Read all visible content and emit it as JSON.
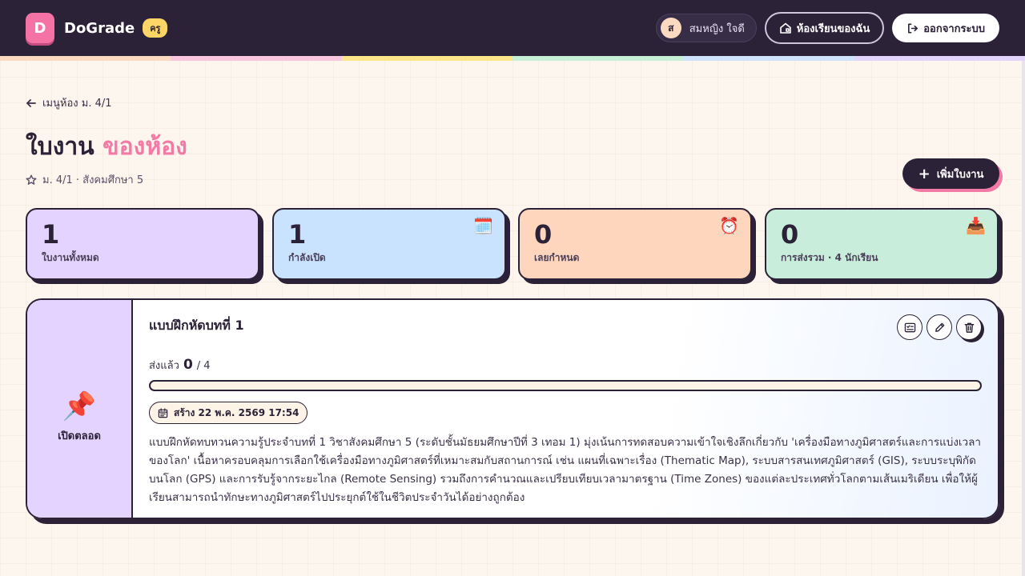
{
  "header": {
    "logo_letter": "D",
    "brand": "DoGrade",
    "role_badge": "ครู",
    "user": {
      "initial": "ส",
      "name": "สมหญิง ใจดี"
    },
    "my_classroom_label": "ห้องเรียนของฉัน",
    "logout_label": "ออกจากระบบ"
  },
  "rainbow_colors": [
    "#fcd9c1",
    "#f9c6dd",
    "#fde68a",
    "#c8f0d7",
    "#cfe3fc",
    "#e3d4fb"
  ],
  "nav": {
    "back_label": "เมนูห้อง ม. 4/1"
  },
  "page": {
    "title_main": "ใบงาน ",
    "title_accent": "ของห้อง",
    "subtitle": "ม. 4/1 · สังคมศึกษา 5",
    "add_button_label": "เพิ่มใบงาน"
  },
  "stats": [
    {
      "value": "1",
      "label": "ใบงานทั้งหมด",
      "color": "#e4d3ff",
      "icon": ""
    },
    {
      "value": "1",
      "label": "กำลังเปิด",
      "color": "#c9e2fd",
      "icon": "🗓️"
    },
    {
      "value": "0",
      "label": "เลยกำหนด",
      "color": "#fdd6bd",
      "icon": "⏰"
    },
    {
      "value": "0",
      "label": "การส่งรวม · 4 นักเรียน",
      "color": "#c8eedb",
      "icon": "📥"
    }
  ],
  "worksheet": {
    "status_label": "เปิดตลอด",
    "status_icon": "📌",
    "title": "แบบฝึกหัดบทที่ 1",
    "submitted_prefix": "ส่งแล้ว",
    "submitted_count": "0",
    "submitted_total": "/ 4",
    "progress_fraction": 0,
    "created_label": "สร้าง 22 พ.ค. 2569 17:54",
    "description": "แบบฝึกหัดทบทวนความรู้ประจำบทที่ 1 วิชาสังคมศึกษา 5 (ระดับชั้นมัธยมศึกษาปีที่ 3 เทอม 1) มุ่งเน้นการทดสอบความเข้าใจเชิงลึกเกี่ยวกับ 'เครื่องมือทางภูมิศาสตร์และการแบ่งเวลาของโลก' เนื้อหาครอบคลุมการเลือกใช้เครื่องมือทางภูมิศาสตร์ที่เหมาะสมกับสถานการณ์ เช่น แผนที่เฉพาะเรื่อง (Thematic Map), ระบบสารสนเทศภูมิศาสตร์ (GIS), ระบบระบุพิกัดบนโลก (GPS) และการรับรู้จากระยะไกล (Remote Sensing) รวมถึงการคำนวณและเปรียบเทียบเวลามาตรฐาน (Time Zones) ของแต่ละประเทศทั่วโลกตามเส้นเมริเดียน เพื่อให้ผู้เรียนสามารถนำทักษะทางภูมิศาสตร์ไปประยุกต์ใช้ในชีวิตประจำวันได้อย่างถูกต้อง"
  }
}
